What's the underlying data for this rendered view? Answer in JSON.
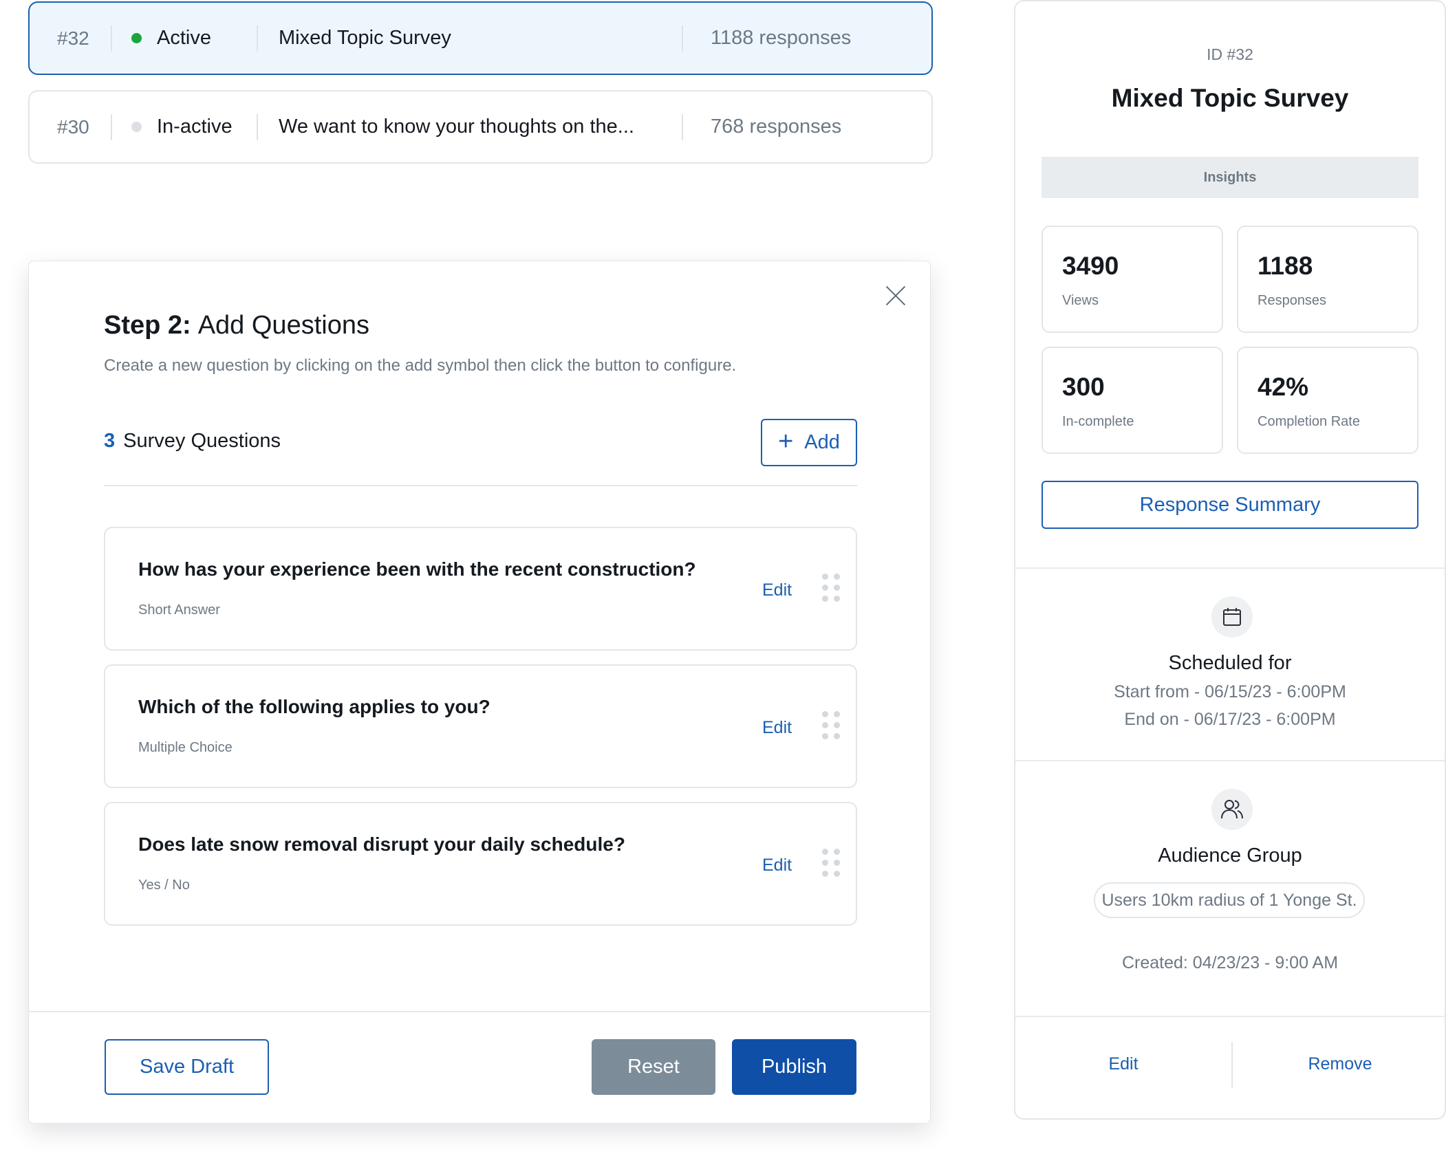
{
  "surveys": [
    {
      "id": "#32",
      "status": "Active",
      "status_color": "#1aa53c",
      "title": "Mixed Topic Survey",
      "responses": "1188 responses"
    },
    {
      "id": "#30",
      "status": "In-active",
      "status_color": "#dcdfe3",
      "title": "We want to know your thoughts on the...",
      "responses": "768 responses"
    }
  ],
  "modal": {
    "step_label": "Step 2:",
    "step_title": "Add Questions",
    "description": "Create a new question by clicking on the add symbol then click the button to configure.",
    "question_count": "3",
    "question_count_label": "Survey Questions",
    "add_label": "Add",
    "questions": [
      {
        "text": "How has your experience been with the recent construction?",
        "type": "Short Answer",
        "edit": "Edit"
      },
      {
        "text": "Which of the following applies to you?",
        "type": "Multiple Choice",
        "edit": "Edit"
      },
      {
        "text": "Does late snow removal disrupt your daily schedule?",
        "type": "Yes / No",
        "edit": "Edit"
      }
    ],
    "save_draft": "Save Draft",
    "reset": "Reset",
    "publish": "Publish"
  },
  "detail": {
    "id_label": "ID #32",
    "title": "Mixed Topic Survey",
    "insights_label": "Insights",
    "stats": [
      {
        "value": "3490",
        "label": "Views"
      },
      {
        "value": "1188",
        "label": "Responses"
      },
      {
        "value": "300",
        "label": "In-complete"
      },
      {
        "value": "42%",
        "label": "Completion Rate"
      }
    ],
    "response_summary": "Response Summary",
    "schedule": {
      "icon": "calendar-icon",
      "title": "Scheduled for",
      "start": "Start from - 06/15/23 - 6:00PM",
      "end": "End on - 06/17/23 - 6:00PM"
    },
    "audience": {
      "icon": "users-icon",
      "title": "Audience Group",
      "group": "Users 10km radius of 1 Yonge St."
    },
    "created": "Created: 04/23/23 - 9:00 AM",
    "edit": "Edit",
    "remove": "Remove"
  },
  "colors": {
    "primary": "#1b5fb3",
    "publish": "#0f4fa8",
    "reset": "#7c8c99",
    "selected_bg": "#eef6fd"
  }
}
